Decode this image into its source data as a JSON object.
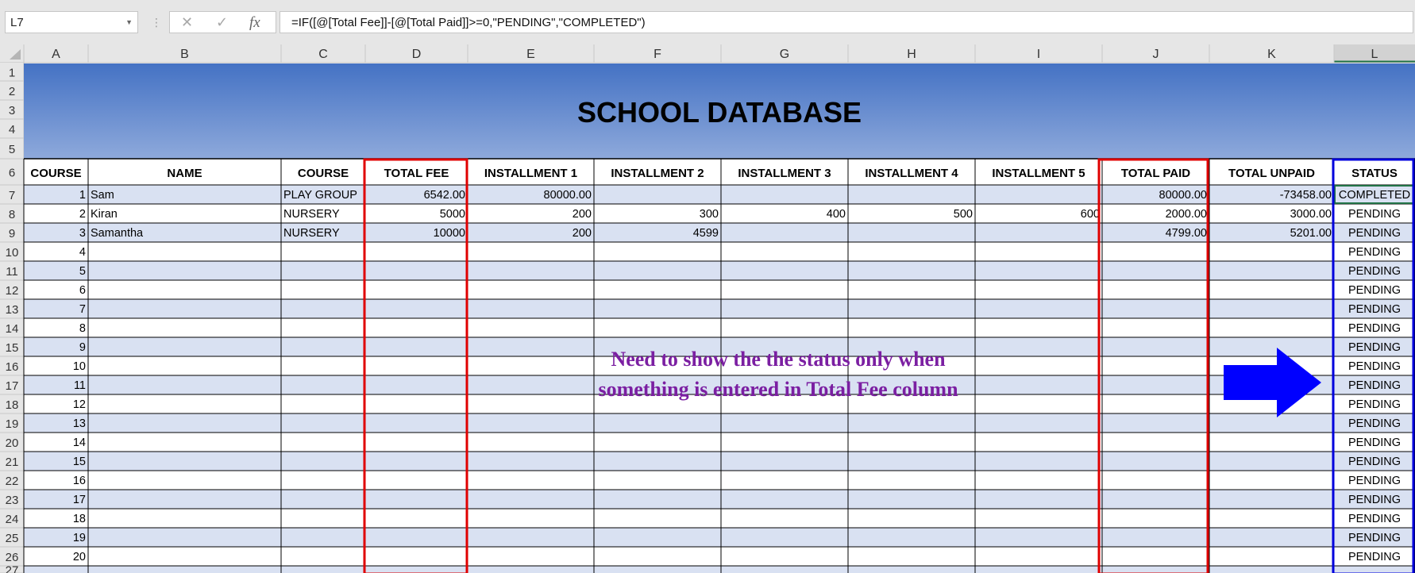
{
  "name_box": {
    "value": "L7"
  },
  "formula_bar": {
    "cancel_glyph": "✕",
    "enter_glyph": "✓",
    "fx_glyph": "fx",
    "formula": "=IF([@[Total Fee]]-[@[Total Paid]]>=0,\"PENDING\",\"COMPLETED\")"
  },
  "sheet": {
    "columns": [
      "A",
      "B",
      "C",
      "D",
      "E",
      "F",
      "G",
      "H",
      "I",
      "J",
      "K",
      "L"
    ],
    "title": "SCHOOL DATABASE",
    "headers": [
      "COURSE",
      "NAME",
      "COURSE",
      "TOTAL FEE",
      "INSTALLMENT 1",
      "INSTALLMENT 2",
      "INSTALLMENT 3",
      "INSTALLMENT 4",
      "INSTALLMENT 5",
      "TOTAL PAID",
      "TOTAL UNPAID",
      "STATUS"
    ],
    "row_numbers": [
      "1",
      "2",
      "3",
      "4",
      "5",
      "6",
      "7",
      "8",
      "9",
      "10",
      "11",
      "12",
      "13",
      "14",
      "15",
      "16",
      "17",
      "18",
      "19",
      "20",
      "21",
      "22",
      "23",
      "24",
      "25",
      "26",
      "27"
    ],
    "rows": [
      [
        "1",
        "Sam",
        "PLAY GROUP",
        "6542.00",
        "80000.00",
        "",
        "",
        "",
        "",
        "80000.00",
        "-73458.00",
        "COMPLETED"
      ],
      [
        "2",
        "Kiran",
        "NURSERY",
        "5000",
        "200",
        "300",
        "400",
        "500",
        "600",
        "2000.00",
        "3000.00",
        "PENDING"
      ],
      [
        "3",
        "Samantha",
        "NURSERY",
        "10000",
        "200",
        "4599",
        "",
        "",
        "",
        "4799.00",
        "5201.00",
        "PENDING"
      ],
      [
        "4",
        "",
        "",
        "",
        "",
        "",
        "",
        "",
        "",
        "",
        "",
        "PENDING"
      ],
      [
        "5",
        "",
        "",
        "",
        "",
        "",
        "",
        "",
        "",
        "",
        "",
        "PENDING"
      ],
      [
        "6",
        "",
        "",
        "",
        "",
        "",
        "",
        "",
        "",
        "",
        "",
        "PENDING"
      ],
      [
        "7",
        "",
        "",
        "",
        "",
        "",
        "",
        "",
        "",
        "",
        "",
        "PENDING"
      ],
      [
        "8",
        "",
        "",
        "",
        "",
        "",
        "",
        "",
        "",
        "",
        "",
        "PENDING"
      ],
      [
        "9",
        "",
        "",
        "",
        "",
        "",
        "",
        "",
        "",
        "",
        "",
        "PENDING"
      ],
      [
        "10",
        "",
        "",
        "",
        "",
        "",
        "",
        "",
        "",
        "",
        "",
        "PENDING"
      ],
      [
        "11",
        "",
        "",
        "",
        "",
        "",
        "",
        "",
        "",
        "",
        "",
        "PENDING"
      ],
      [
        "12",
        "",
        "",
        "",
        "",
        "",
        "",
        "",
        "",
        "",
        "",
        "PENDING"
      ],
      [
        "13",
        "",
        "",
        "",
        "",
        "",
        "",
        "",
        "",
        "",
        "",
        "PENDING"
      ],
      [
        "14",
        "",
        "",
        "",
        "",
        "",
        "",
        "",
        "",
        "",
        "",
        "PENDING"
      ],
      [
        "15",
        "",
        "",
        "",
        "",
        "",
        "",
        "",
        "",
        "",
        "",
        "PENDING"
      ],
      [
        "16",
        "",
        "",
        "",
        "",
        "",
        "",
        "",
        "",
        "",
        "",
        "PENDING"
      ],
      [
        "17",
        "",
        "",
        "",
        "",
        "",
        "",
        "",
        "",
        "",
        "",
        "PENDING"
      ],
      [
        "18",
        "",
        "",
        "",
        "",
        "",
        "",
        "",
        "",
        "",
        "",
        "PENDING"
      ],
      [
        "19",
        "",
        "",
        "",
        "",
        "",
        "",
        "",
        "",
        "",
        "",
        "PENDING"
      ],
      [
        "20",
        "",
        "",
        "",
        "",
        "",
        "",
        "",
        "",
        "",
        "",
        "PENDING"
      ]
    ],
    "active_cell": "L7"
  },
  "annotation": {
    "line1": "Need to show the the status only when",
    "line2": "something is entered in Total Fee column"
  },
  "colors": {
    "title_band_top": "#4472c4",
    "title_band_bottom": "#8ea9db",
    "banded_row": "#d9e1f2",
    "highlight_red": "#e00000",
    "highlight_blue": "#0000dd",
    "arrow": "#0000ff",
    "annotation_text": "#7b1fa2"
  }
}
